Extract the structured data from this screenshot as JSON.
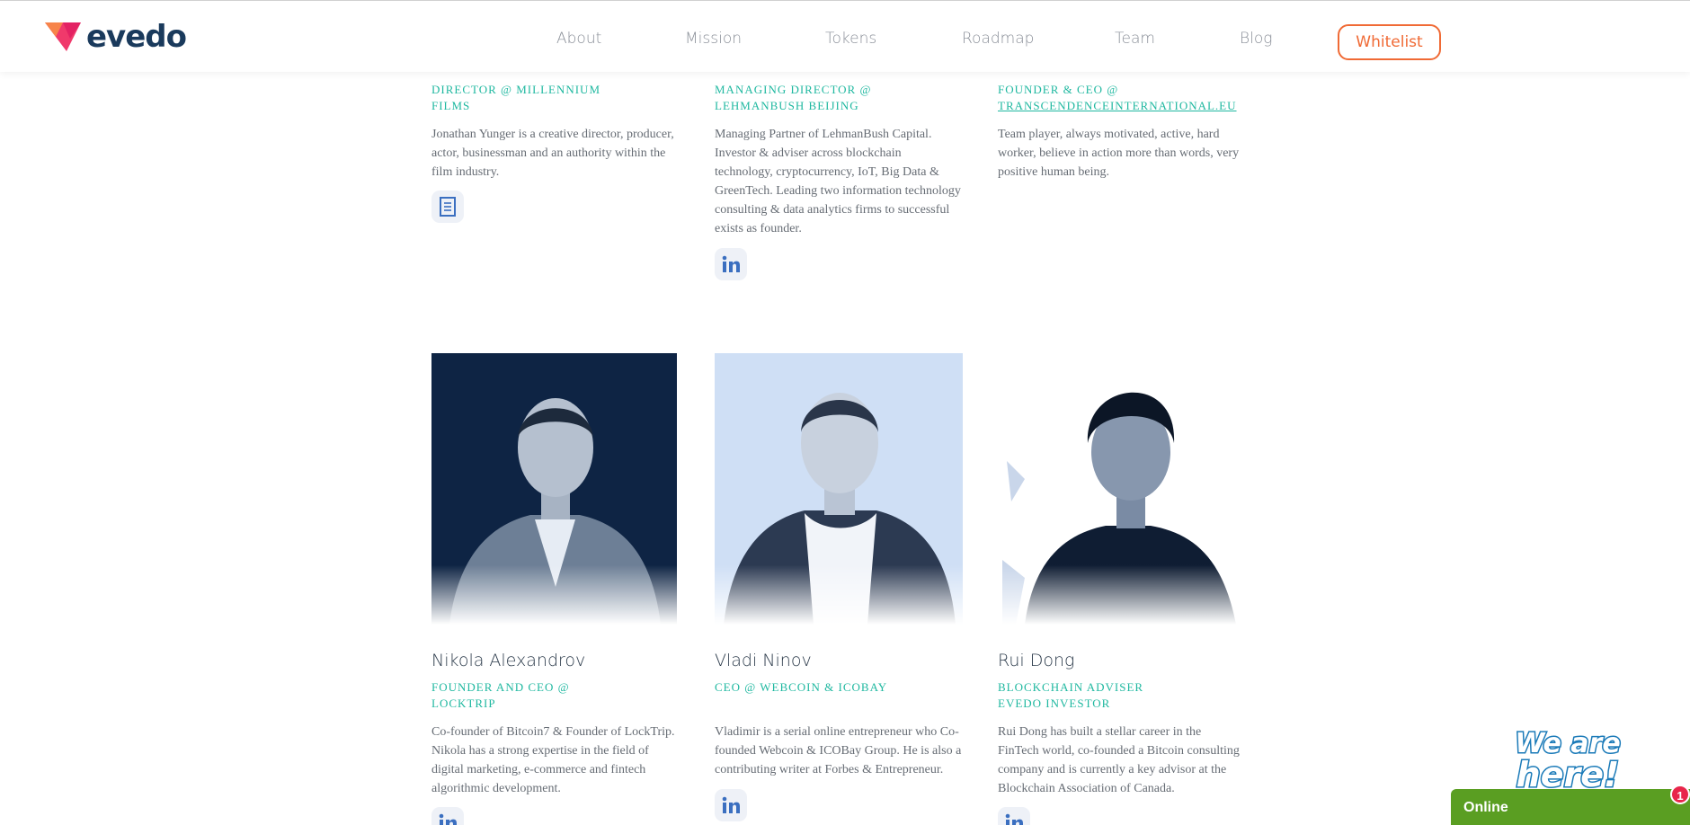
{
  "header": {
    "logo_text": "evedo",
    "nav": [
      "About",
      "Mission",
      "Tokens",
      "Roadmap",
      "Team",
      "Blog"
    ],
    "whitelist_label": "Whitelist"
  },
  "top_row": [
    {
      "role_line1": "DIRECTOR @ MILLENNIUM",
      "role_line2": "FILMS",
      "bio": [
        "Jonathan Yunger is a creative director, producer,",
        "actor, businessman and an authority within the",
        "film industry."
      ],
      "social_icon": "document-icon"
    },
    {
      "role_line1": "MANAGING DIRECTOR @",
      "role_line2": "LEHMANBUSH BEIJING",
      "bio": [
        "Managing Partner of LehmanBush Capital.",
        "Investor & adviser across blockchain",
        "technology, cryptocurrency, IoT, Big Data &",
        "GreenTech. Leading two information technology",
        "consulting & data analytics firms to successful",
        "exists as founder."
      ],
      "social_icon": "linkedin-icon"
    },
    {
      "role_line1": "FOUNDER & CEO @",
      "role_line2": "TRANSCENDENCEINTERNATIONAL.EU",
      "bio": [
        "Team player, always motivated, active, hard",
        "worker, believe in action more than words, very",
        "positive human being."
      ],
      "social_icon": ""
    }
  ],
  "bottom_row": [
    {
      "name": "Nikola Alexandrov",
      "role_line1": "FOUNDER AND CEO @",
      "role_line2": "LOCKTRIP",
      "bio": [
        "Co-founder of Bitcoin7 & Founder of LockTrip.",
        "Nikola has a strong expertise in the field of",
        "digital marketing, e-commerce and fintech",
        "algorithmic development."
      ],
      "social_icon": "linkedin-icon"
    },
    {
      "name": "Vladi Ninov",
      "role_line1": "CEO @ WEBCOIN & ICOBAY",
      "role_line2": "",
      "bio": [
        "Vladimir is a serial online entrepreneur who Co-",
        "founded Webcoin & ICOBay Group. He is also a",
        "contributing writer at Forbes & Entrepreneur."
      ],
      "social_icon": "linkedin-icon"
    },
    {
      "name": "Rui Dong",
      "role_line1": "BLOCKCHAIN ADVISER",
      "role_line2": "EVEDO INVESTOR",
      "bio": [
        "Rui Dong has built a stellar career in the",
        "FinTech world, co-founded a Bitcoin consulting",
        "company and is currently a key advisor at the",
        "Blockchain Association of Canada."
      ],
      "social_icon": "linkedin-icon"
    }
  ],
  "chat": {
    "banner_text": "We are here!",
    "status": "Online",
    "badge_count": "1"
  },
  "colors": {
    "accent_teal": "#1fb8a0",
    "whitelist_orange": "#f06a35",
    "chat_green": "#5a9e22",
    "badge_red": "#e8264b",
    "linkedin_blue": "#3b6fc0"
  }
}
